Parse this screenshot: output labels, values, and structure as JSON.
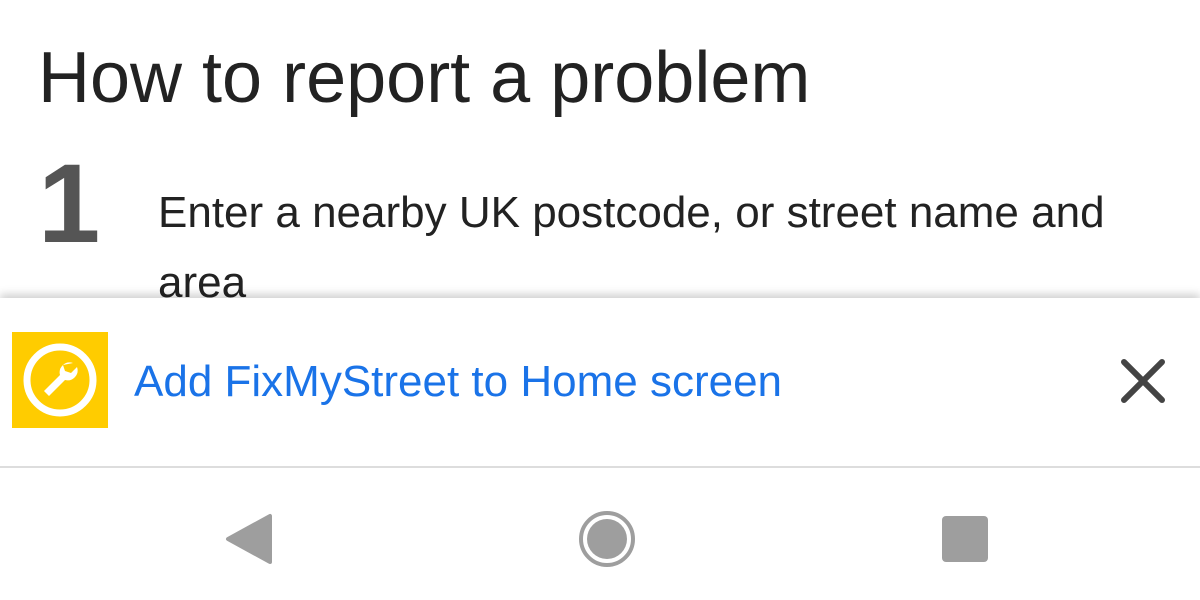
{
  "page": {
    "title": "How to report a problem",
    "steps": [
      {
        "number": "1",
        "text": "Enter a nearby UK postcode, or street name and area"
      }
    ]
  },
  "install_banner": {
    "label": "Add FixMyStreet to Home screen",
    "app_icon": "wrench-icon",
    "close_icon": "close-icon"
  },
  "system_nav": {
    "back_icon": "back-triangle-icon",
    "home_icon": "home-circle-icon",
    "recents_icon": "recents-square-icon"
  },
  "colors": {
    "link": "#1a73e8",
    "app_icon_bg": "#ffcc00",
    "nav_gray": "#9e9e9e",
    "text": "#222222"
  }
}
